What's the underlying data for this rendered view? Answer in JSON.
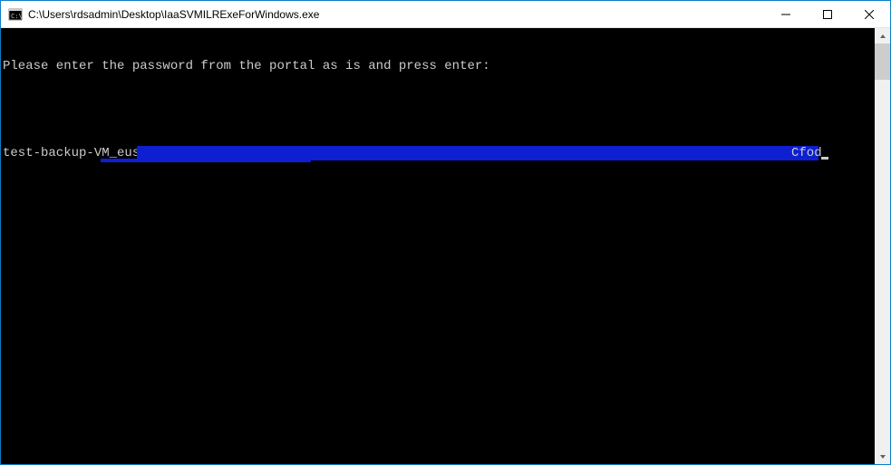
{
  "titlebar": {
    "path": "C:\\Users\\rdsadmin\\Desktop\\IaaSVMILRExeForWindows.exe"
  },
  "console": {
    "prompt_line": "Please enter the password from the portal as is and press enter:",
    "input_prefix": "test-backup-VM_eus",
    "redacted_tail": "Cfod"
  }
}
